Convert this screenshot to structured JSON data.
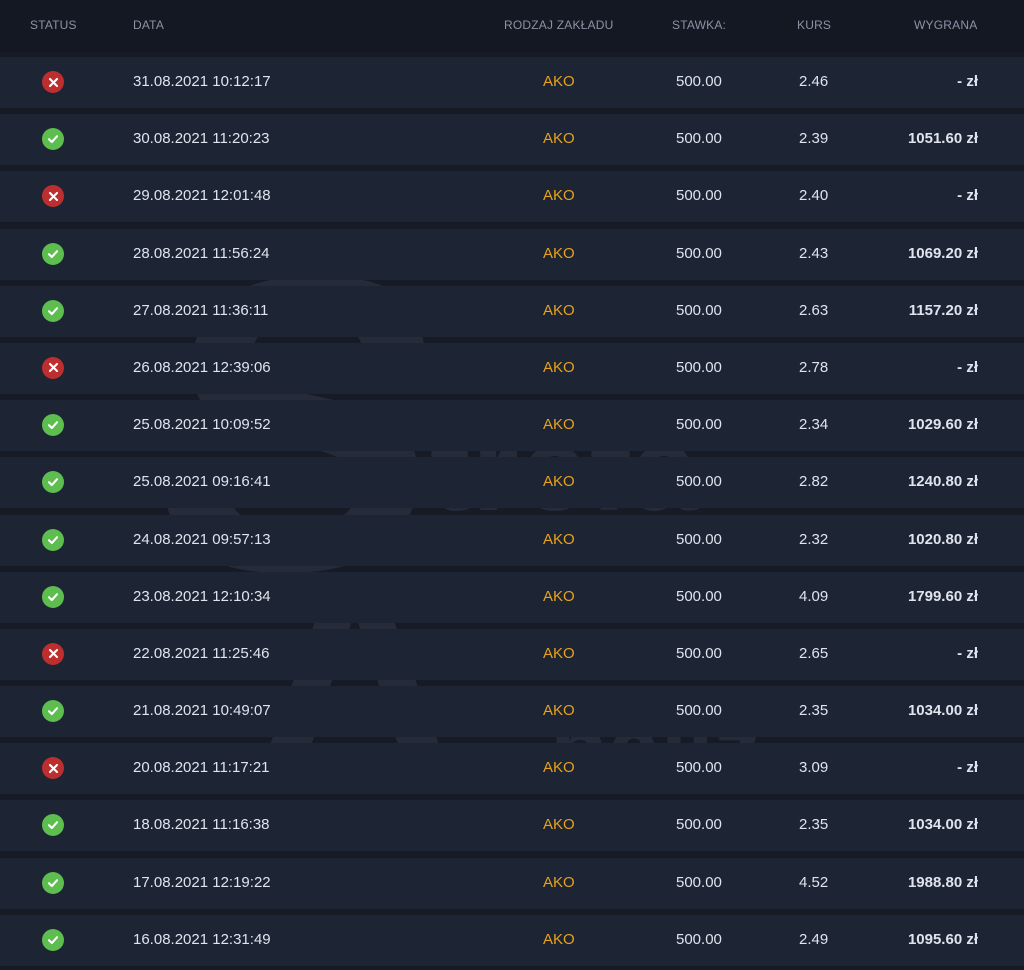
{
  "table": {
    "headers": {
      "status": "STATUS",
      "date": "DATA",
      "type": "RODZAJ ZAKŁADU",
      "stake": "STAWKA:",
      "odds": "KURS",
      "win": "WYGRANA"
    },
    "rows": [
      {
        "status": "fail",
        "date": "31.08.2021 10:12:17",
        "type": "AKO",
        "stake": "500.00",
        "odds": "2.46",
        "win": "- zł"
      },
      {
        "status": "ok",
        "date": "30.08.2021 11:20:23",
        "type": "AKO",
        "stake": "500.00",
        "odds": "2.39",
        "win": "1051.60 zł"
      },
      {
        "status": "fail",
        "date": "29.08.2021 12:01:48",
        "type": "AKO",
        "stake": "500.00",
        "odds": "2.40",
        "win": "- zł"
      },
      {
        "status": "ok",
        "date": "28.08.2021 11:56:24",
        "type": "AKO",
        "stake": "500.00",
        "odds": "2.43",
        "win": "1069.20 zł"
      },
      {
        "status": "ok",
        "date": "27.08.2021 11:36:11",
        "type": "AKO",
        "stake": "500.00",
        "odds": "2.63",
        "win": "1157.20 zł"
      },
      {
        "status": "fail",
        "date": "26.08.2021 12:39:06",
        "type": "AKO",
        "stake": "500.00",
        "odds": "2.78",
        "win": "- zł"
      },
      {
        "status": "ok",
        "date": "25.08.2021 10:09:52",
        "type": "AKO",
        "stake": "500.00",
        "odds": "2.34",
        "win": "1029.60 zł"
      },
      {
        "status": "ok",
        "date": "25.08.2021 09:16:41",
        "type": "AKO",
        "stake": "500.00",
        "odds": "2.82",
        "win": "1240.80 zł"
      },
      {
        "status": "ok",
        "date": "24.08.2021 09:57:13",
        "type": "AKO",
        "stake": "500.00",
        "odds": "2.32",
        "win": "1020.80 zł"
      },
      {
        "status": "ok",
        "date": "23.08.2021 12:10:34",
        "type": "AKO",
        "stake": "500.00",
        "odds": "4.09",
        "win": "1799.60 zł"
      },
      {
        "status": "fail",
        "date": "22.08.2021 11:25:46",
        "type": "AKO",
        "stake": "500.00",
        "odds": "2.65",
        "win": "- zł"
      },
      {
        "status": "ok",
        "date": "21.08.2021 10:49:07",
        "type": "AKO",
        "stake": "500.00",
        "odds": "2.35",
        "win": "1034.00 zł"
      },
      {
        "status": "fail",
        "date": "20.08.2021 11:17:21",
        "type": "AKO",
        "stake": "500.00",
        "odds": "3.09",
        "win": "- zł"
      },
      {
        "status": "ok",
        "date": "18.08.2021 11:16:38",
        "type": "AKO",
        "stake": "500.00",
        "odds": "2.35",
        "win": "1034.00 zł"
      },
      {
        "status": "ok",
        "date": "17.08.2021 12:19:22",
        "type": "AKO",
        "stake": "500.00",
        "odds": "4.52",
        "win": "1988.80 zł"
      },
      {
        "status": "ok",
        "date": "16.08.2021 12:31:49",
        "type": "AKO",
        "stake": "500.00",
        "odds": "2.49",
        "win": "1095.60 zł"
      }
    ]
  },
  "watermark": {
    "big_letter": "S",
    "word1": "trefa",
    "letter_a": "A",
    "word2": "naliz"
  },
  "colors": {
    "background": "#161b26",
    "header_bg": "#131822",
    "row_bg": "#1d2433",
    "text": "#dfe4ee",
    "accent": "#e8a21b",
    "status_ok": "#5ebd4f",
    "status_fail": "#bd2f2f"
  },
  "icons": {
    "ok": "check-icon",
    "fail": "close-icon"
  }
}
